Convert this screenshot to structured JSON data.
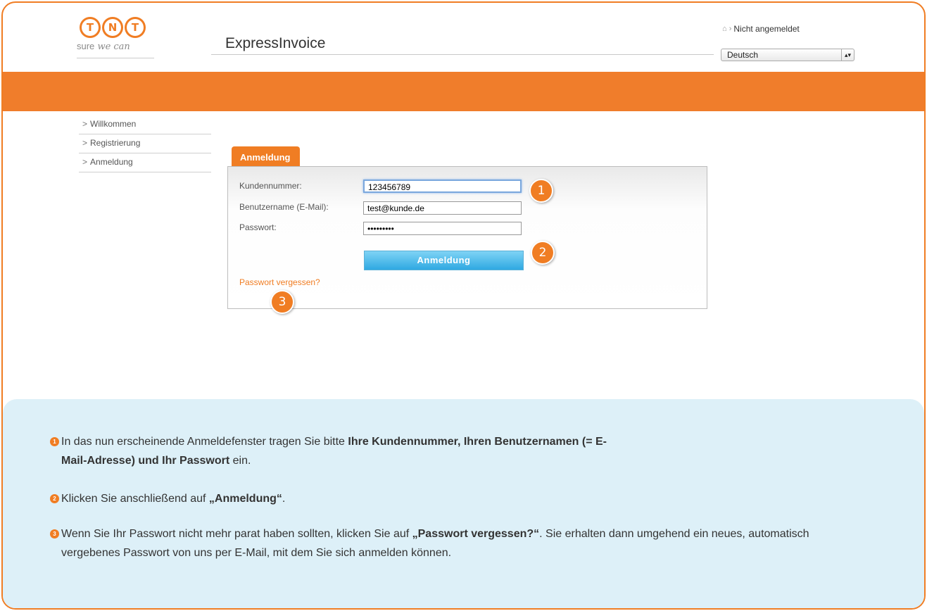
{
  "header": {
    "logo_letters": [
      "T",
      "N",
      "T"
    ],
    "logo_tagline_prefix": "sure",
    "logo_tagline_script": "we can",
    "app_title": "ExpressInvoice",
    "login_status": "Nicht angemeldet",
    "language": "Deutsch"
  },
  "sidebar": {
    "items": [
      {
        "label": "Willkommen"
      },
      {
        "label": "Registrierung"
      },
      {
        "label": "Anmeldung"
      }
    ]
  },
  "login": {
    "tab_label": "Anmeldung",
    "customer_number_label": "Kundennummer:",
    "customer_number_value": "123456789",
    "username_label": "Benutzername (E-Mail):",
    "username_value": "test@kunde.de",
    "password_label": "Passwort:",
    "password_value": "•••••••••",
    "submit_label": "Anmeldung",
    "forgot_password": "Passwort vergessen?"
  },
  "markers": [
    "1",
    "2",
    "3"
  ],
  "instructions": {
    "step1": {
      "number": "1",
      "before": "In das nun erscheinende Anmeldefenster tragen Sie bitte ",
      "bold": "Ihre Kundennummer, Ihren Benutzernamen (= E-Mail-Adresse) und Ihr Passwort",
      "after": " ein."
    },
    "step2": {
      "number": "2",
      "before": "Klicken Sie anschließend auf ",
      "bold": "„Anmeldung“",
      "after": "."
    },
    "step3": {
      "number": "3",
      "before": "Wenn Sie Ihr Passwort nicht mehr parat haben sollten, klicken Sie auf ",
      "bold": "„Passwort vergessen?“",
      "after": ". Sie erhalten dann umgehend ein neues, automatisch vergebenes Passwort von uns per E-Mail, mit dem Sie sich anmelden können."
    }
  },
  "colors": {
    "brand_orange": "#f07d23",
    "button_blue": "#2fa9e2",
    "instruction_bg": "#ddf0f8"
  }
}
